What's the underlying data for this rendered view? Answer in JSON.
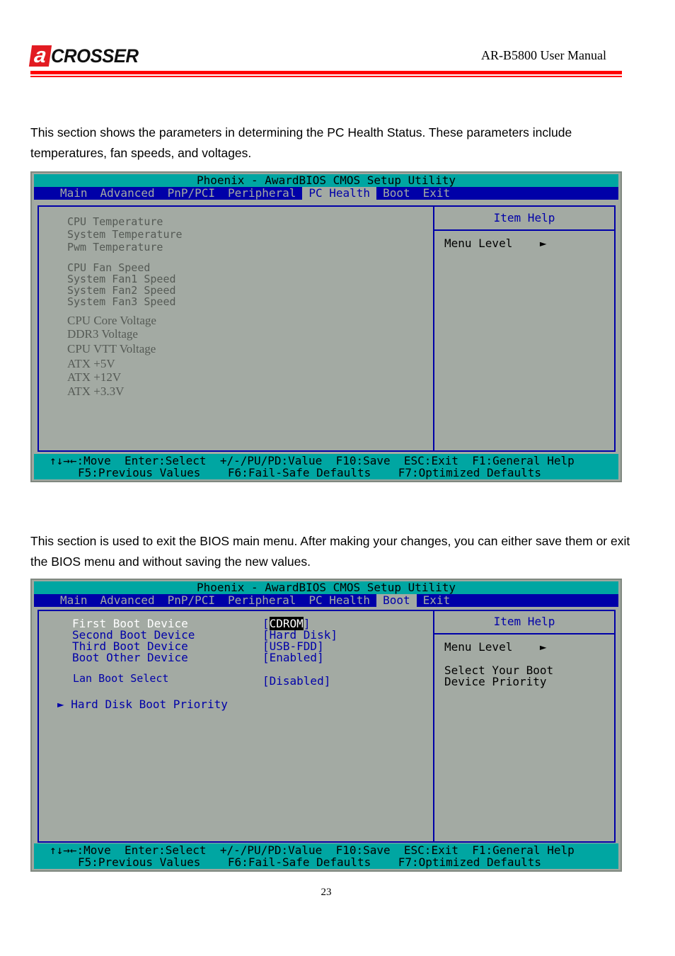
{
  "header": {
    "logo_mark": "a",
    "logo_text": "CROSSER",
    "manual_title": "AR-B5800 User Manual",
    "brand_color": "#e21b22"
  },
  "section1": {
    "text": "This section shows the parameters in determining the PC Health Status. These parameters include temperatures, fan speeds, and voltages."
  },
  "bios_common": {
    "title": "Phoenix - AwardBIOS CMOS Setup Utility",
    "menu": [
      "Main",
      "Advanced",
      "PnP/PCI",
      "Peripheral",
      "PC Health",
      "Boot",
      "Exit"
    ],
    "item_help": "Item Help",
    "menu_level": "Menu Level",
    "menu_level_arrow": "►",
    "footer_line1": "↑↓→←:Move  Enter:Select  +/-/PU/PD:Value  F10:Save  ESC:Exit  F1:General Help",
    "footer_line2": "F5:Previous Values    F6:Fail-Safe Defaults    F7:Optimized Defaults",
    "colors": {
      "title_bar": "#00a6a2",
      "menu_bar": "#0000a8",
      "panel": "#a3aaa3"
    }
  },
  "bios_health": {
    "active_tab": "PC Health",
    "temperatures": [
      "CPU Temperature",
      "System Temperature",
      "Pwm Temperature"
    ],
    "fans": [
      "CPU Fan Speed",
      "System Fan1 Speed",
      "System Fan2 Speed",
      "System Fan3 Speed"
    ],
    "voltages": [
      "CPU Core Voltage",
      "DDR3 Voltage",
      "CPU VTT Voltage",
      "ATX +5V",
      "ATX +12V",
      "ATX +3.3V"
    ]
  },
  "section2": {
    "text": "This section is used to exit the BIOS main menu. After making your changes, you can either save them or exit the BIOS menu and without saving the new values."
  },
  "bios_boot": {
    "active_tab": "Boot",
    "items": [
      {
        "label": "First Boot Device",
        "value_open": "[",
        "value": "CDROM",
        "value_close": "]",
        "selected": true
      },
      {
        "label": "Second Boot Device",
        "value": "[Hard Disk]"
      },
      {
        "label": "Third Boot Device",
        "value": "[USB-FDD]"
      },
      {
        "label": "Boot Other Device",
        "value": "[Enabled]"
      },
      {
        "label": "Lan Boot Select",
        "value": "[Disabled]"
      }
    ],
    "submenu_arrow": "►",
    "submenu": "Hard Disk Boot Priority",
    "help_text_line1": "Select Your Boot",
    "help_text_line2": "Device Priority"
  },
  "footer": {
    "page_number": "23"
  }
}
